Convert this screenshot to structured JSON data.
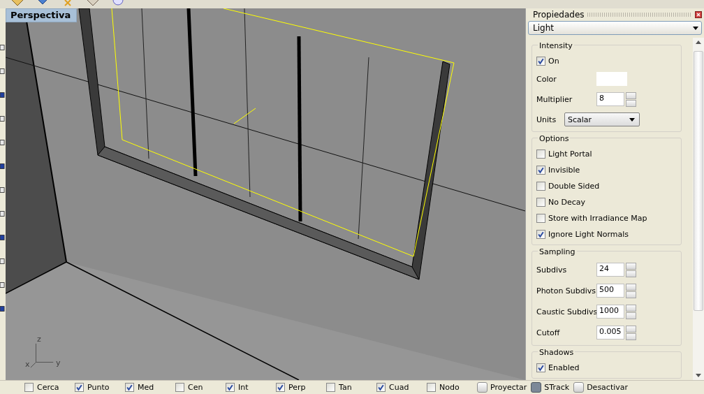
{
  "viewport": {
    "label": "Perspectiva",
    "axes": {
      "z": "z",
      "x": "x",
      "y": "y"
    }
  },
  "properties": {
    "title": "Propiedades",
    "type_select": "Light",
    "groups": [
      {
        "title": "Intensity",
        "rows": [
          {
            "kind": "checkbox",
            "label": "On",
            "checked": true
          },
          {
            "kind": "color",
            "label": "Color"
          },
          {
            "kind": "spinner",
            "label": "Multiplier",
            "value": "8"
          },
          {
            "kind": "select",
            "label": "Units",
            "value": "Scalar"
          }
        ]
      },
      {
        "title": "Options",
        "rows": [
          {
            "kind": "checkbox",
            "label": "Light Portal",
            "checked": false
          },
          {
            "kind": "checkbox",
            "label": "Invisible",
            "checked": true
          },
          {
            "kind": "checkbox",
            "label": "Double Sided",
            "checked": false
          },
          {
            "kind": "checkbox",
            "label": "No Decay",
            "checked": false
          },
          {
            "kind": "checkbox",
            "label": "Store with Irradiance Map",
            "checked": false
          },
          {
            "kind": "checkbox",
            "label": "Ignore Light Normals",
            "checked": true
          }
        ]
      },
      {
        "title": "Sampling",
        "rows": [
          {
            "kind": "spinner",
            "label": "Subdivs",
            "value": "24"
          },
          {
            "kind": "spinner",
            "label": "Photon Subdivs",
            "value": "500"
          },
          {
            "kind": "spinner",
            "label": "Caustic Subdivs",
            "value": "1000"
          },
          {
            "kind": "spinner",
            "label": "Cutoff",
            "value": "0.005"
          }
        ]
      },
      {
        "title": "Shadows",
        "rows": [
          {
            "kind": "checkbox",
            "label": "Enabled",
            "checked": true
          }
        ]
      }
    ]
  },
  "status_bar": [
    {
      "kind": "check",
      "label": "Cerca",
      "checked": false
    },
    {
      "kind": "check",
      "label": "Punto",
      "checked": true
    },
    {
      "kind": "check",
      "label": "Med",
      "checked": true
    },
    {
      "kind": "check",
      "label": "Cen",
      "checked": false
    },
    {
      "kind": "check",
      "label": "Int",
      "checked": true
    },
    {
      "kind": "check",
      "label": "Perp",
      "checked": true
    },
    {
      "kind": "check",
      "label": "Tan",
      "checked": false
    },
    {
      "kind": "check",
      "label": "Cuad",
      "checked": true
    },
    {
      "kind": "check",
      "label": "Nodo",
      "checked": false
    },
    {
      "kind": "toggle",
      "label": "Proyectar",
      "on": false
    },
    {
      "kind": "toggle",
      "label": "STrack",
      "on": true
    },
    {
      "kind": "toggle",
      "label": "Desactivar",
      "on": false
    }
  ]
}
